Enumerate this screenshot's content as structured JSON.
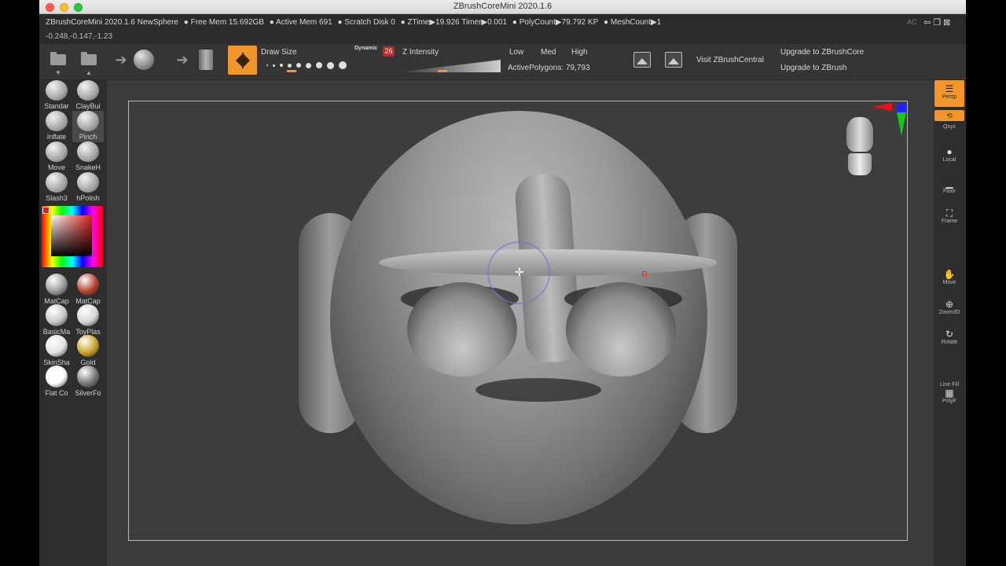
{
  "window": {
    "title": "ZBrushCoreMini 2020.1.6"
  },
  "infobar": {
    "app_label": "ZBrushCoreMini 2020.1.6 NewSphere",
    "free_mem": "● Free Mem 15.692GB",
    "active_mem": "● Active Mem 691",
    "scratch_disk": "● Scratch Disk 0",
    "ztime": "● ZTime▶19.926 Timer▶0.001",
    "polycount": "● PolyCount▶79.792 KP",
    "meshcount": "● MeshCount▶1",
    "coords": "-0.248,-0.147,-1.23",
    "ac": "AC"
  },
  "toolbar": {
    "draw_size_label": "Draw Size",
    "dynamic_label": "Dynamic",
    "draw_size_value": "26",
    "z_intensity_label": "Z Intensity",
    "low_label": "Low",
    "med_label": "Med",
    "high_label": "High",
    "active_polygons": "ActivePolygons: 79,793",
    "visit_label": "Visit ZBrushCentral",
    "upgrade_core": "Upgrade to ZBrushCore",
    "upgrade_zbrush": "Upgrade to ZBrush"
  },
  "brushes": [
    {
      "label": "Standar"
    },
    {
      "label": "ClayBui"
    },
    {
      "label": "Inflate"
    },
    {
      "label": "Pinch"
    },
    {
      "label": "Move"
    },
    {
      "label": "SnakeH"
    },
    {
      "label": "Slash3"
    },
    {
      "label": "hPolish"
    }
  ],
  "materials": [
    {
      "label": "MatCap",
      "color": "#9a9a9a"
    },
    {
      "label": "MatCap",
      "color": "#b5402c"
    },
    {
      "label": "BasicMa",
      "color": "#c8c8c8"
    },
    {
      "label": "ToyPlas",
      "color": "#d6d6d6"
    },
    {
      "label": "SkinSha",
      "color": "#e0e0e0"
    },
    {
      "label": "Gold",
      "color": "#c9a227"
    },
    {
      "label": "Flat Co",
      "color": "#ffffff"
    },
    {
      "label": "SilverFo",
      "color": "#777777"
    }
  ],
  "right_shelf": {
    "persp": "Persp",
    "xyz": "Qxyz",
    "local": "Local",
    "floor": "Floor",
    "frame": "Frame",
    "move": "Move",
    "zoom3d": "Zoom3D",
    "rotate": "Rotate",
    "linefill": "Line Fill",
    "polyf": "PolyF"
  },
  "colors": {
    "accent": "#f0962a",
    "brush_size_badge": "#c12727"
  }
}
